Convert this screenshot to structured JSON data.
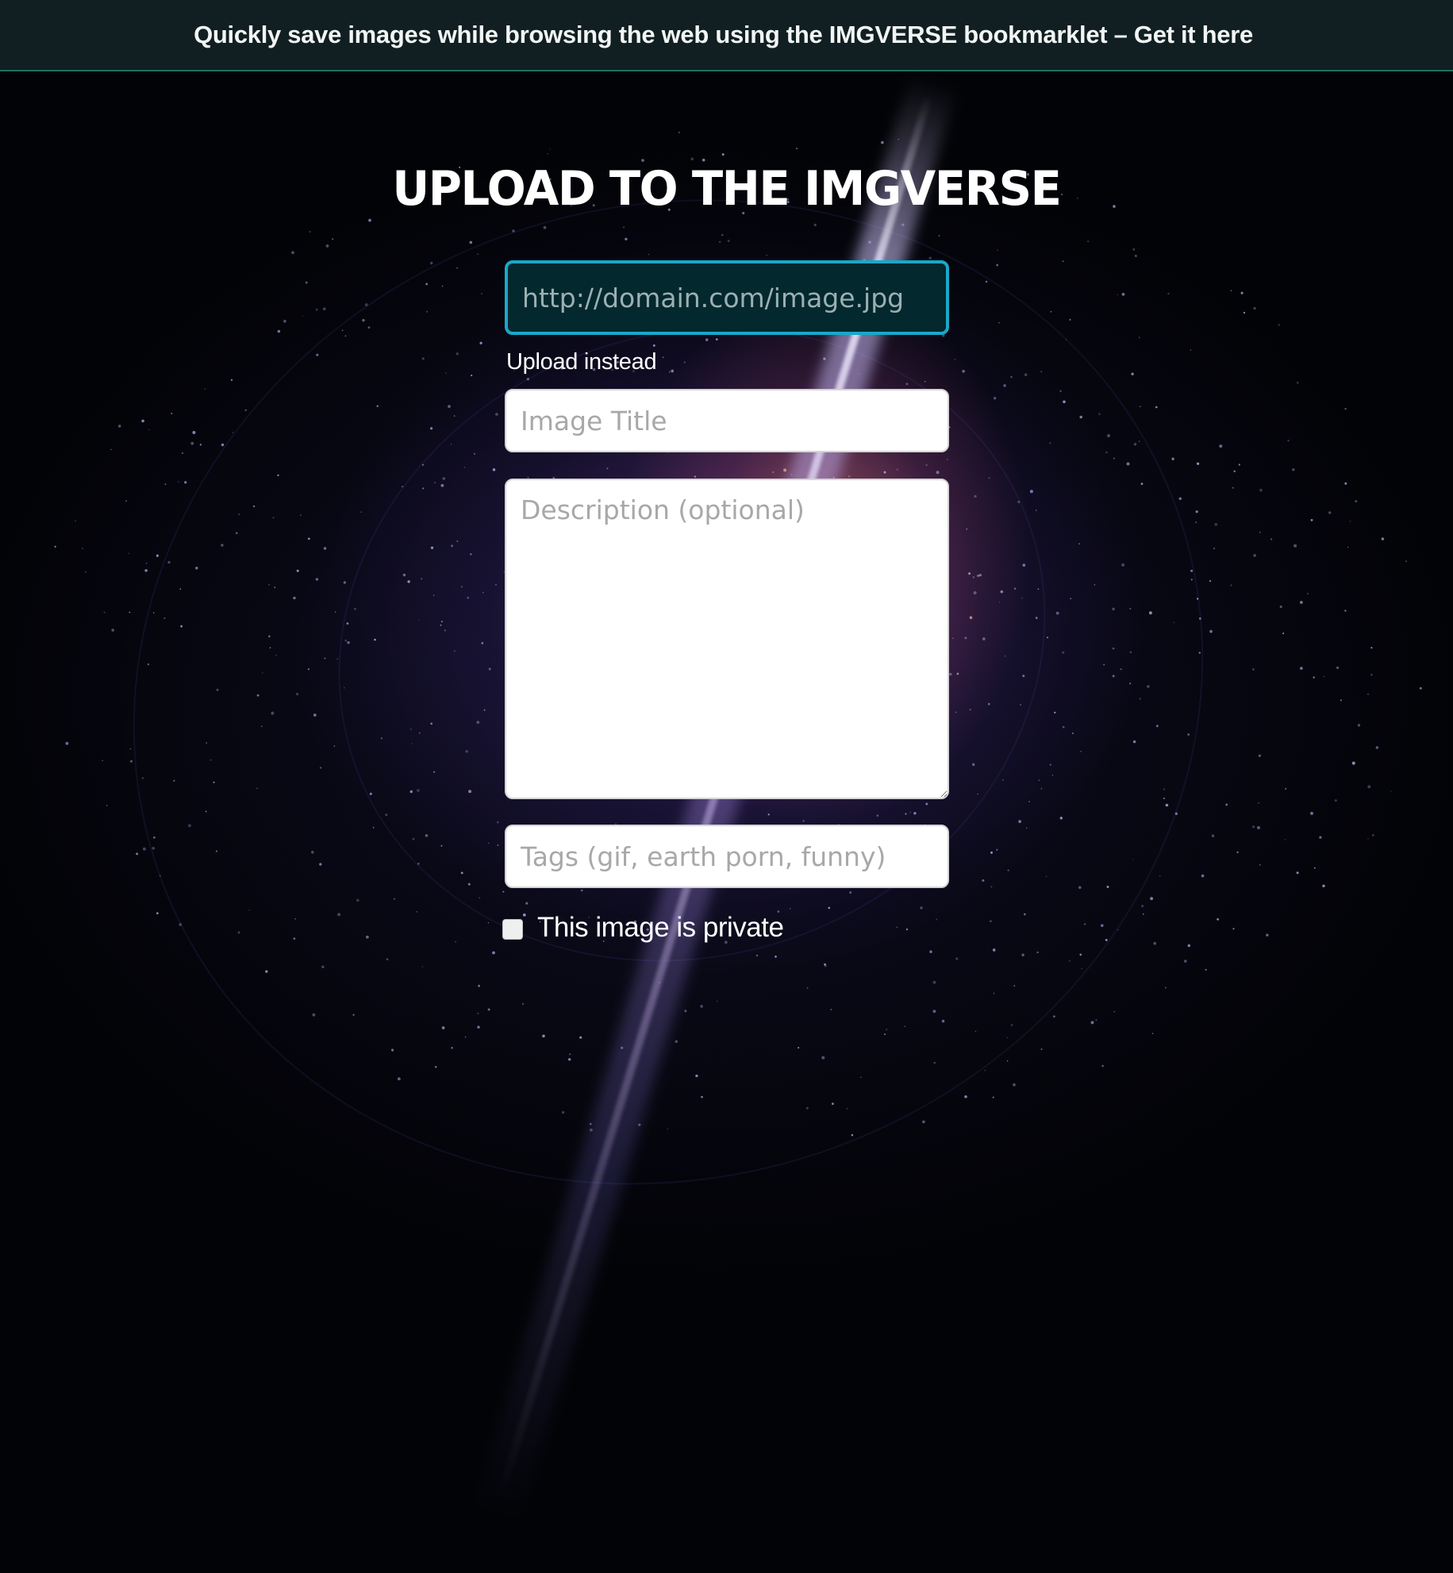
{
  "banner": {
    "message": "Quickly save images while browsing the web using the IMGVERSE bookmarklet –",
    "link_label": "Get it here"
  },
  "page": {
    "title": "UPLOAD TO THE IMGVERSE"
  },
  "form": {
    "url_placeholder": "http://domain.com/image.jpg",
    "upload_instead_label": "Upload instead",
    "title_placeholder": "Image Title",
    "description_placeholder": "Description (optional)",
    "tags_placeholder": "Tags (gif, earth porn, funny)",
    "private_label": "This image is private",
    "private_checked": false
  },
  "colors": {
    "banner_bg": "#111f22",
    "banner_border": "#1f6e64",
    "url_border_focus": "#1aa8c9",
    "url_bg": "#03282e"
  }
}
